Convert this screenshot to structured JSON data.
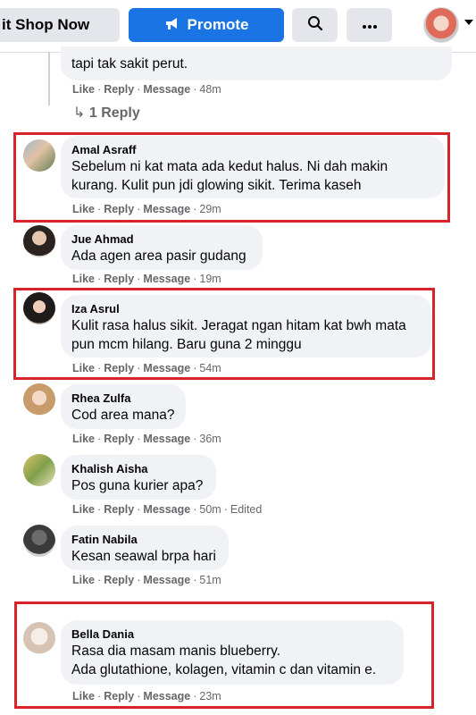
{
  "topbar": {
    "shop_label": "it Shop Now",
    "promote_label": "Promote"
  },
  "thread": {
    "prev_text": "tapi tak sakit perut.",
    "prev_time": "48m",
    "reply_link": "1 Reply"
  },
  "actions": {
    "like": "Like",
    "reply": "Reply",
    "message": "Message"
  },
  "comments": [
    {
      "name": "Amal Asraff",
      "text": "Sebelum ni kat mata ada kedut halus. Ni dah makin kurang. Kulit pun jdi glowing sikit. Terima kaseh",
      "time": "29m",
      "edited": ""
    },
    {
      "name": "Jue Ahmad",
      "text": "Ada agen area pasir gudang",
      "time": "19m",
      "edited": ""
    },
    {
      "name": "Iza Asrul",
      "text": "Kulit rasa halus sikit. Jeragat ngan hitam kat bwh mata pun mcm hilang. Baru guna 2 minggu",
      "time": "54m",
      "edited": ""
    },
    {
      "name": "Rhea Zulfa",
      "text": "Cod area mana?",
      "time": "36m",
      "edited": ""
    },
    {
      "name": "Khalish Aisha",
      "text": "Pos guna kurier apa?",
      "time": "50m",
      "edited": "Edited"
    },
    {
      "name": "Fatin Nabila",
      "text": "Kesan seawal brpa hari",
      "time": "51m",
      "edited": ""
    },
    {
      "name": "Bella Dania",
      "text": "Rasa dia masam manis blueberry.\nAda glutathione, kolagen, vitamin c dan vitamin e.",
      "time": "23m",
      "edited": ""
    }
  ],
  "colors": {
    "accent": "#1b74e4",
    "highlight": "#d8232a",
    "bubble": "#f0f2f5",
    "meta": "#65676b"
  }
}
